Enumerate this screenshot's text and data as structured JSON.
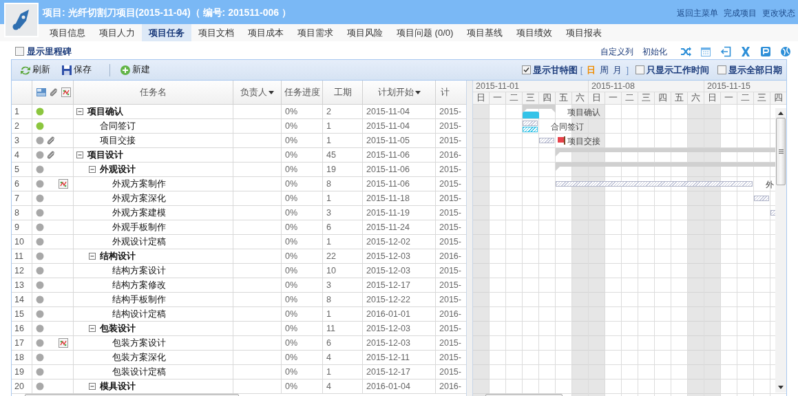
{
  "header": {
    "title": "项目: 光纤切割刀项目(2015-11-04)（ 编号: 201511-006 ）",
    "links": [
      "返回主菜单",
      "完成项目",
      "更改状态"
    ]
  },
  "tabs": [
    {
      "label": "项目信息",
      "selected": false
    },
    {
      "label": "项目人力",
      "selected": false
    },
    {
      "label": "项目任务",
      "selected": true
    },
    {
      "label": "项目文档",
      "selected": false
    },
    {
      "label": "项目成本",
      "selected": false
    },
    {
      "label": "项目需求",
      "selected": false
    },
    {
      "label": "项目风险",
      "selected": false
    },
    {
      "label": "项目问题 (0/0)",
      "selected": false
    },
    {
      "label": "项目基线",
      "selected": false
    },
    {
      "label": "项目绩效",
      "selected": false
    },
    {
      "label": "项目报表",
      "selected": false
    }
  ],
  "options": {
    "milestones": {
      "label": "显示里程碑",
      "checked": false
    },
    "actions": [
      "自定义列",
      "初始化"
    ]
  },
  "toolbar": {
    "buttons": [
      {
        "label": "刷新",
        "kind": "refresh"
      },
      {
        "label": "保存",
        "kind": "save"
      },
      {
        "label": "新建",
        "kind": "new"
      }
    ],
    "gantt_toggle": {
      "label": "显示甘特图",
      "checked": true
    },
    "bracket_open": "[",
    "scales": [
      {
        "label": "日",
        "selected": true
      },
      {
        "label": "周",
        "selected": false
      },
      {
        "label": "月",
        "selected": false
      }
    ],
    "bracket_close": "]",
    "work_time_only": {
      "label": "只显示工作时间",
      "checked": false
    },
    "all_dates": {
      "label": "显示全部日期",
      "checked": false
    }
  },
  "grid": {
    "columns": [
      {
        "label": "任务名",
        "sort_menu": false
      },
      {
        "label": "负责人",
        "sort_menu": true
      },
      {
        "label": "任务进度",
        "sort_menu": false
      },
      {
        "label": "工期",
        "sort_menu": false
      },
      {
        "label": "计划开始",
        "sort_menu": true
      },
      {
        "label": "计",
        "sort_menu": false
      }
    ],
    "rows": [
      {
        "num": "1",
        "color": "#8cc63f",
        "attachment": false,
        "chart": false,
        "name": "项目确认",
        "expanded": true,
        "progress": "0%",
        "duration": "2",
        "start": "2015-11-04",
        "end": "2015-",
        "gantt_label": "项目确认",
        "baseline": true,
        "children": [
          {
            "num": "2",
            "color": "#8cc63f",
            "attachment": false,
            "chart": false,
            "name": "合同签订",
            "progress": "0%",
            "duration": "1",
            "start": "2015-11-04",
            "end": "2015-",
            "gantt_label": "合同签订",
            "baseline": true
          },
          {
            "num": "3",
            "color": "#a8a8a8",
            "attachment": true,
            "chart": false,
            "name": "项目交接",
            "progress": "0%",
            "duration": "1",
            "start": "2015-11-05",
            "end": "2015-",
            "gantt_label": "项目交接",
            "flag": true
          }
        ]
      },
      {
        "num": "4",
        "color": "#a8a8a8",
        "attachment": true,
        "chart": false,
        "name": "项目设计",
        "expanded": true,
        "progress": "0%",
        "duration": "45",
        "start": "2015-11-06",
        "end": "2016-",
        "children": [
          {
            "num": "5",
            "color": "#a8a8a8",
            "attachment": false,
            "chart": false,
            "name": "外观设计",
            "expanded": true,
            "progress": "0%",
            "duration": "19",
            "start": "2015-11-06",
            "end": "2015-",
            "children": [
              {
                "num": "6",
                "color": "#a8a8a8",
                "attachment": false,
                "chart": true,
                "name": "外观方案制作",
                "progress": "0%",
                "duration": "8",
                "start": "2015-11-06",
                "end": "2015-",
                "gantt_label": "外"
              },
              {
                "num": "7",
                "color": "#a8a8a8",
                "attachment": false,
                "chart": false,
                "name": "外观方案深化",
                "progress": "0%",
                "duration": "1",
                "start": "2015-11-18",
                "end": "2015-"
              },
              {
                "num": "8",
                "color": "#a8a8a8",
                "attachment": false,
                "chart": false,
                "name": "外观方案建模",
                "progress": "0%",
                "duration": "3",
                "start": "2015-11-19",
                "end": "2015-"
              },
              {
                "num": "9",
                "color": "#a8a8a8",
                "attachment": false,
                "chart": false,
                "name": "外观手板制作",
                "progress": "0%",
                "duration": "6",
                "start": "2015-11-24",
                "end": "2015-"
              },
              {
                "num": "10",
                "color": "#a8a8a8",
                "attachment": false,
                "chart": false,
                "name": "外观设计定稿",
                "progress": "0%",
                "duration": "1",
                "start": "2015-12-02",
                "end": "2015-"
              }
            ]
          },
          {
            "num": "11",
            "color": "#a8a8a8",
            "attachment": false,
            "chart": false,
            "name": "结构设计",
            "expanded": true,
            "progress": "0%",
            "duration": "22",
            "start": "2015-12-03",
            "end": "2016-",
            "children": [
              {
                "num": "12",
                "color": "#a8a8a8",
                "attachment": false,
                "chart": false,
                "name": "结构方案设计",
                "progress": "0%",
                "duration": "10",
                "start": "2015-12-03",
                "end": "2015-"
              },
              {
                "num": "13",
                "color": "#a8a8a8",
                "attachment": false,
                "chart": false,
                "name": "结构方案修改",
                "progress": "0%",
                "duration": "3",
                "start": "2015-12-17",
                "end": "2015-"
              },
              {
                "num": "14",
                "color": "#a8a8a8",
                "attachment": false,
                "chart": false,
                "name": "结构手板制作",
                "progress": "0%",
                "duration": "8",
                "start": "2015-12-22",
                "end": "2015-"
              },
              {
                "num": "15",
                "color": "#a8a8a8",
                "attachment": false,
                "chart": false,
                "name": "结构设计定稿",
                "progress": "0%",
                "duration": "1",
                "start": "2016-01-01",
                "end": "2016-"
              }
            ]
          },
          {
            "num": "16",
            "color": "#a8a8a8",
            "attachment": false,
            "chart": false,
            "name": "包装设计",
            "expanded": true,
            "progress": "0%",
            "duration": "11",
            "start": "2015-12-03",
            "end": "2015-",
            "children": [
              {
                "num": "17",
                "color": "#a8a8a8",
                "attachment": false,
                "chart": true,
                "name": "包装方案设计",
                "progress": "0%",
                "duration": "6",
                "start": "2015-12-03",
                "end": "2015-"
              },
              {
                "num": "18",
                "color": "#a8a8a8",
                "attachment": false,
                "chart": false,
                "name": "包装方案深化",
                "progress": "0%",
                "duration": "4",
                "start": "2015-12-11",
                "end": "2015-"
              },
              {
                "num": "19",
                "color": "#a8a8a8",
                "attachment": false,
                "chart": false,
                "name": "包装设计定稿",
                "progress": "0%",
                "duration": "1",
                "start": "2015-12-17",
                "end": "2015-"
              }
            ]
          },
          {
            "num": "20",
            "color": "#a8a8a8",
            "attachment": false,
            "chart": false,
            "name": "模具设计",
            "expanded": true,
            "progress": "0%",
            "duration": "4",
            "start": "2016-01-04",
            "end": "2016-"
          }
        ]
      }
    ]
  },
  "gantt": {
    "weeks": [
      "2015-11-01",
      "2015-11-08",
      "2015-11-15"
    ],
    "days": [
      {
        "label": "日",
        "weekend": true
      },
      {
        "label": "一",
        "weekend": false
      },
      {
        "label": "二",
        "weekend": false
      },
      {
        "label": "三",
        "weekend": false
      },
      {
        "label": "四",
        "weekend": false
      },
      {
        "label": "五",
        "weekend": false
      },
      {
        "label": "六",
        "weekend": true
      },
      {
        "label": "日",
        "weekend": true
      },
      {
        "label": "一",
        "weekend": false
      },
      {
        "label": "二",
        "weekend": false
      },
      {
        "label": "三",
        "weekend": false
      },
      {
        "label": "四",
        "weekend": false
      },
      {
        "label": "五",
        "weekend": false
      },
      {
        "label": "六",
        "weekend": true
      },
      {
        "label": "日",
        "weekend": true
      },
      {
        "label": "一",
        "weekend": false
      },
      {
        "label": "二",
        "weekend": false
      },
      {
        "label": "三",
        "weekend": false
      },
      {
        "label": "四",
        "weekend": false
      }
    ]
  }
}
